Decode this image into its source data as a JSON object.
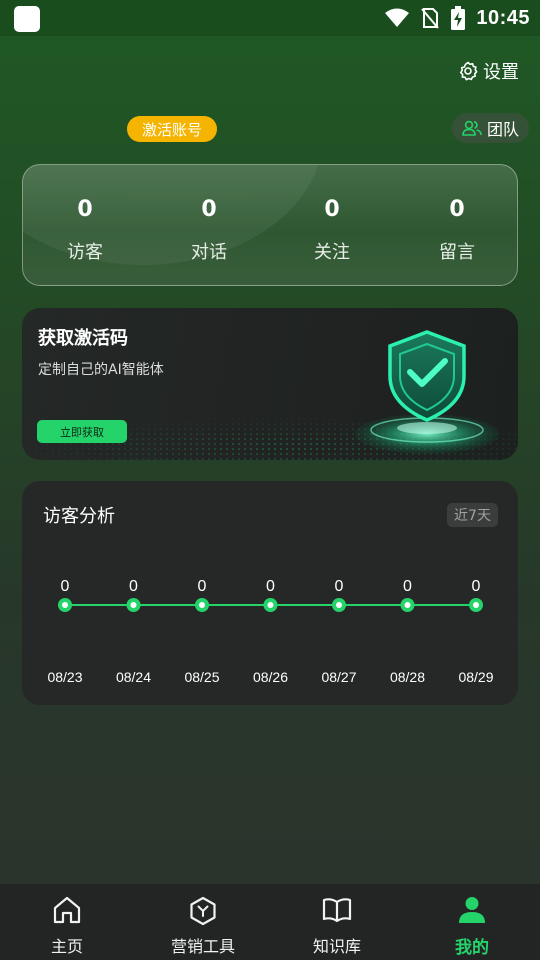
{
  "status_bar": {
    "time": "10:45"
  },
  "header": {
    "settings_label": "设置",
    "activate_label": "激活账号",
    "team_label": "团队"
  },
  "stats": [
    {
      "value": "0",
      "label": "访客"
    },
    {
      "value": "0",
      "label": "对话"
    },
    {
      "value": "0",
      "label": "关注"
    },
    {
      "value": "0",
      "label": "留言"
    }
  ],
  "promo": {
    "title": "获取激活码",
    "subtitle": "定制自己的AI智能体",
    "button_label": "立即获取"
  },
  "chart_data": {
    "type": "line",
    "title": "访客分析",
    "range_label": "近7天",
    "categories": [
      "08/23",
      "08/24",
      "08/25",
      "08/26",
      "08/27",
      "08/28",
      "08/29"
    ],
    "values": [
      0,
      0,
      0,
      0,
      0,
      0,
      0
    ],
    "data_labels": true,
    "grid": false,
    "color": "#25d36b"
  },
  "bottom_nav": [
    {
      "label": "主页",
      "icon": "home-icon",
      "active": false
    },
    {
      "label": "营销工具",
      "icon": "hexagon-tool-icon",
      "active": false
    },
    {
      "label": "知识库",
      "icon": "book-icon",
      "active": false
    },
    {
      "label": "我的",
      "icon": "person-icon",
      "active": true
    }
  ],
  "colors": {
    "accent": "#25d36b",
    "badge": "#f4b400"
  }
}
